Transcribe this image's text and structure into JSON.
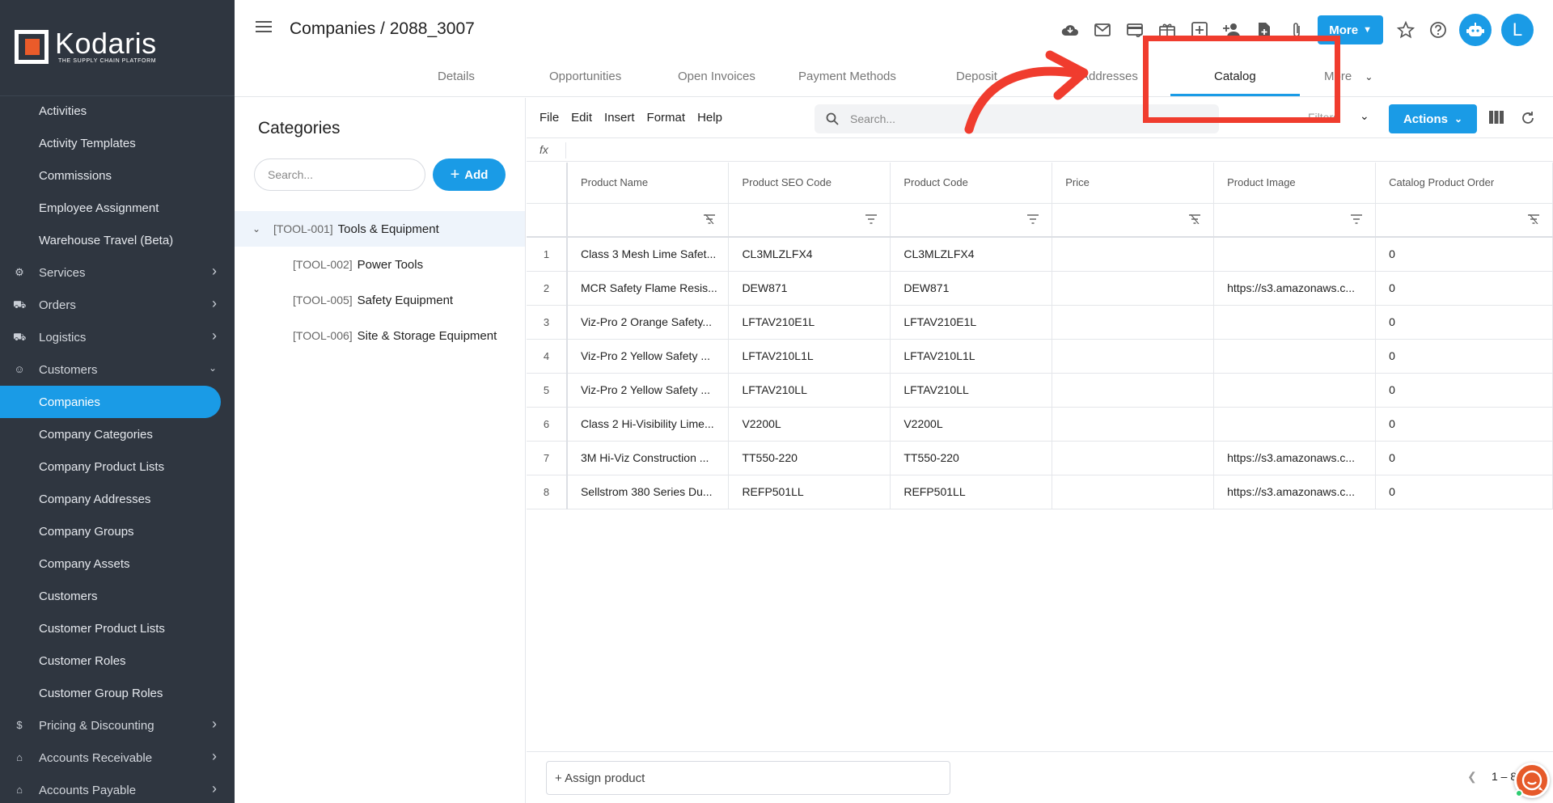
{
  "app": {
    "logo_name": "Kodaris",
    "logo_tagline": "THE SUPPLY CHAIN PLATFORM"
  },
  "sidebar": {
    "items": [
      {
        "label": "Activities",
        "kind": "sub"
      },
      {
        "label": "Activity Templates",
        "kind": "sub"
      },
      {
        "label": "Commissions",
        "kind": "sub"
      },
      {
        "label": "Employee Assignment",
        "kind": "sub"
      },
      {
        "label": "Warehouse Travel (Beta)",
        "kind": "sub"
      },
      {
        "label": "Services",
        "kind": "top",
        "icon": "gears-icon",
        "chevron": "right"
      },
      {
        "label": "Orders",
        "kind": "top",
        "icon": "truck-icon",
        "chevron": "right"
      },
      {
        "label": "Logistics",
        "kind": "top",
        "icon": "shipping-icon",
        "chevron": "right"
      },
      {
        "label": "Customers",
        "kind": "top",
        "icon": "people-icon",
        "chevron": "down"
      },
      {
        "label": "Companies",
        "kind": "sub",
        "active": true
      },
      {
        "label": "Company Categories",
        "kind": "sub"
      },
      {
        "label": "Company Product Lists",
        "kind": "sub"
      },
      {
        "label": "Company Addresses",
        "kind": "sub"
      },
      {
        "label": "Company Groups",
        "kind": "sub"
      },
      {
        "label": "Company Assets",
        "kind": "sub"
      },
      {
        "label": "Customers",
        "kind": "sub"
      },
      {
        "label": "Customer Product Lists",
        "kind": "sub"
      },
      {
        "label": "Customer Roles",
        "kind": "sub"
      },
      {
        "label": "Customer Group Roles",
        "kind": "sub"
      },
      {
        "label": "Pricing & Discounting",
        "kind": "top",
        "icon": "dollar-icon",
        "chevron": "right"
      },
      {
        "label": "Accounts Receivable",
        "kind": "top",
        "icon": "bank-icon",
        "chevron": "right"
      },
      {
        "label": "Accounts Payable",
        "kind": "top",
        "icon": "bank-icon",
        "chevron": "right"
      }
    ]
  },
  "header": {
    "title": "Companies / 2088_3007",
    "more_label": "More",
    "avatar_initial": "L",
    "icons": [
      "cloud-icon",
      "mail-icon",
      "card-icon",
      "gift-icon",
      "add-box-icon",
      "add-person-icon",
      "add-file-icon",
      "attach-icon"
    ]
  },
  "tabs": [
    {
      "label": "Details"
    },
    {
      "label": "Opportunities"
    },
    {
      "label": "Open Invoices"
    },
    {
      "label": "Payment Methods"
    },
    {
      "label": "Deposit"
    },
    {
      "label": "Addresses"
    },
    {
      "label": "Catalog",
      "active": true
    },
    {
      "label": "More"
    }
  ],
  "categories": {
    "title": "Categories",
    "search_placeholder": "Search...",
    "add_label": "Add",
    "tree": [
      {
        "code": "[TOOL-001]",
        "label": "Tools & Equipment",
        "level": 0,
        "selected": true
      },
      {
        "code": "[TOOL-002]",
        "label": "Power Tools",
        "level": 1
      },
      {
        "code": "[TOOL-005]",
        "label": "Safety Equipment",
        "level": 1
      },
      {
        "code": "[TOOL-006]",
        "label": "Site & Storage Equipment",
        "level": 1
      }
    ]
  },
  "grid": {
    "menu": [
      "File",
      "Edit",
      "Insert",
      "Format",
      "Help"
    ],
    "search_placeholder": "Search...",
    "filter_label": "Filters",
    "actions_label": "Actions",
    "fx_label": "fx",
    "columns": [
      "Product Name",
      "Product SEO Code",
      "Product Code",
      "Price",
      "Product Image",
      "Catalog Product Order"
    ],
    "rows": [
      [
        "1",
        "Class 3 Mesh Lime Safet...",
        "CL3MLZLFX4",
        "CL3MLZLFX4",
        "",
        "",
        "0"
      ],
      [
        "2",
        "MCR Safety Flame Resis...",
        "DEW871",
        "DEW871",
        "",
        "https://s3.amazonaws.c...",
        "0"
      ],
      [
        "3",
        "Viz-Pro 2 Orange Safety...",
        "LFTAV210E1L",
        "LFTAV210E1L",
        "",
        "",
        "0"
      ],
      [
        "4",
        "Viz-Pro 2 Yellow Safety ...",
        "LFTAV210L1L",
        "LFTAV210L1L",
        "",
        "",
        "0"
      ],
      [
        "5",
        "Viz-Pro 2 Yellow Safety ...",
        "LFTAV210LL",
        "LFTAV210LL",
        "",
        "",
        "0"
      ],
      [
        "6",
        "Class 2 Hi-Visibility Lime...",
        "V2200L",
        "V2200L",
        "",
        "",
        "0"
      ],
      [
        "7",
        "3M Hi-Viz Construction ...",
        "TT550-220",
        "TT550-220",
        "",
        "https://s3.amazonaws.c...",
        "0"
      ],
      [
        "8",
        "Sellstrom 380 Series Du...",
        "REFP501LL",
        "REFP501LL",
        "",
        "https://s3.amazonaws.c...",
        "0"
      ]
    ],
    "assign_label": "+ Assign product",
    "pager_text": "1 – 8"
  },
  "colors": {
    "accent": "#1a9be6",
    "sidebar_bg": "#2f3640",
    "annotation": "#f03c2e",
    "help_bubble": "#e65a2a"
  }
}
